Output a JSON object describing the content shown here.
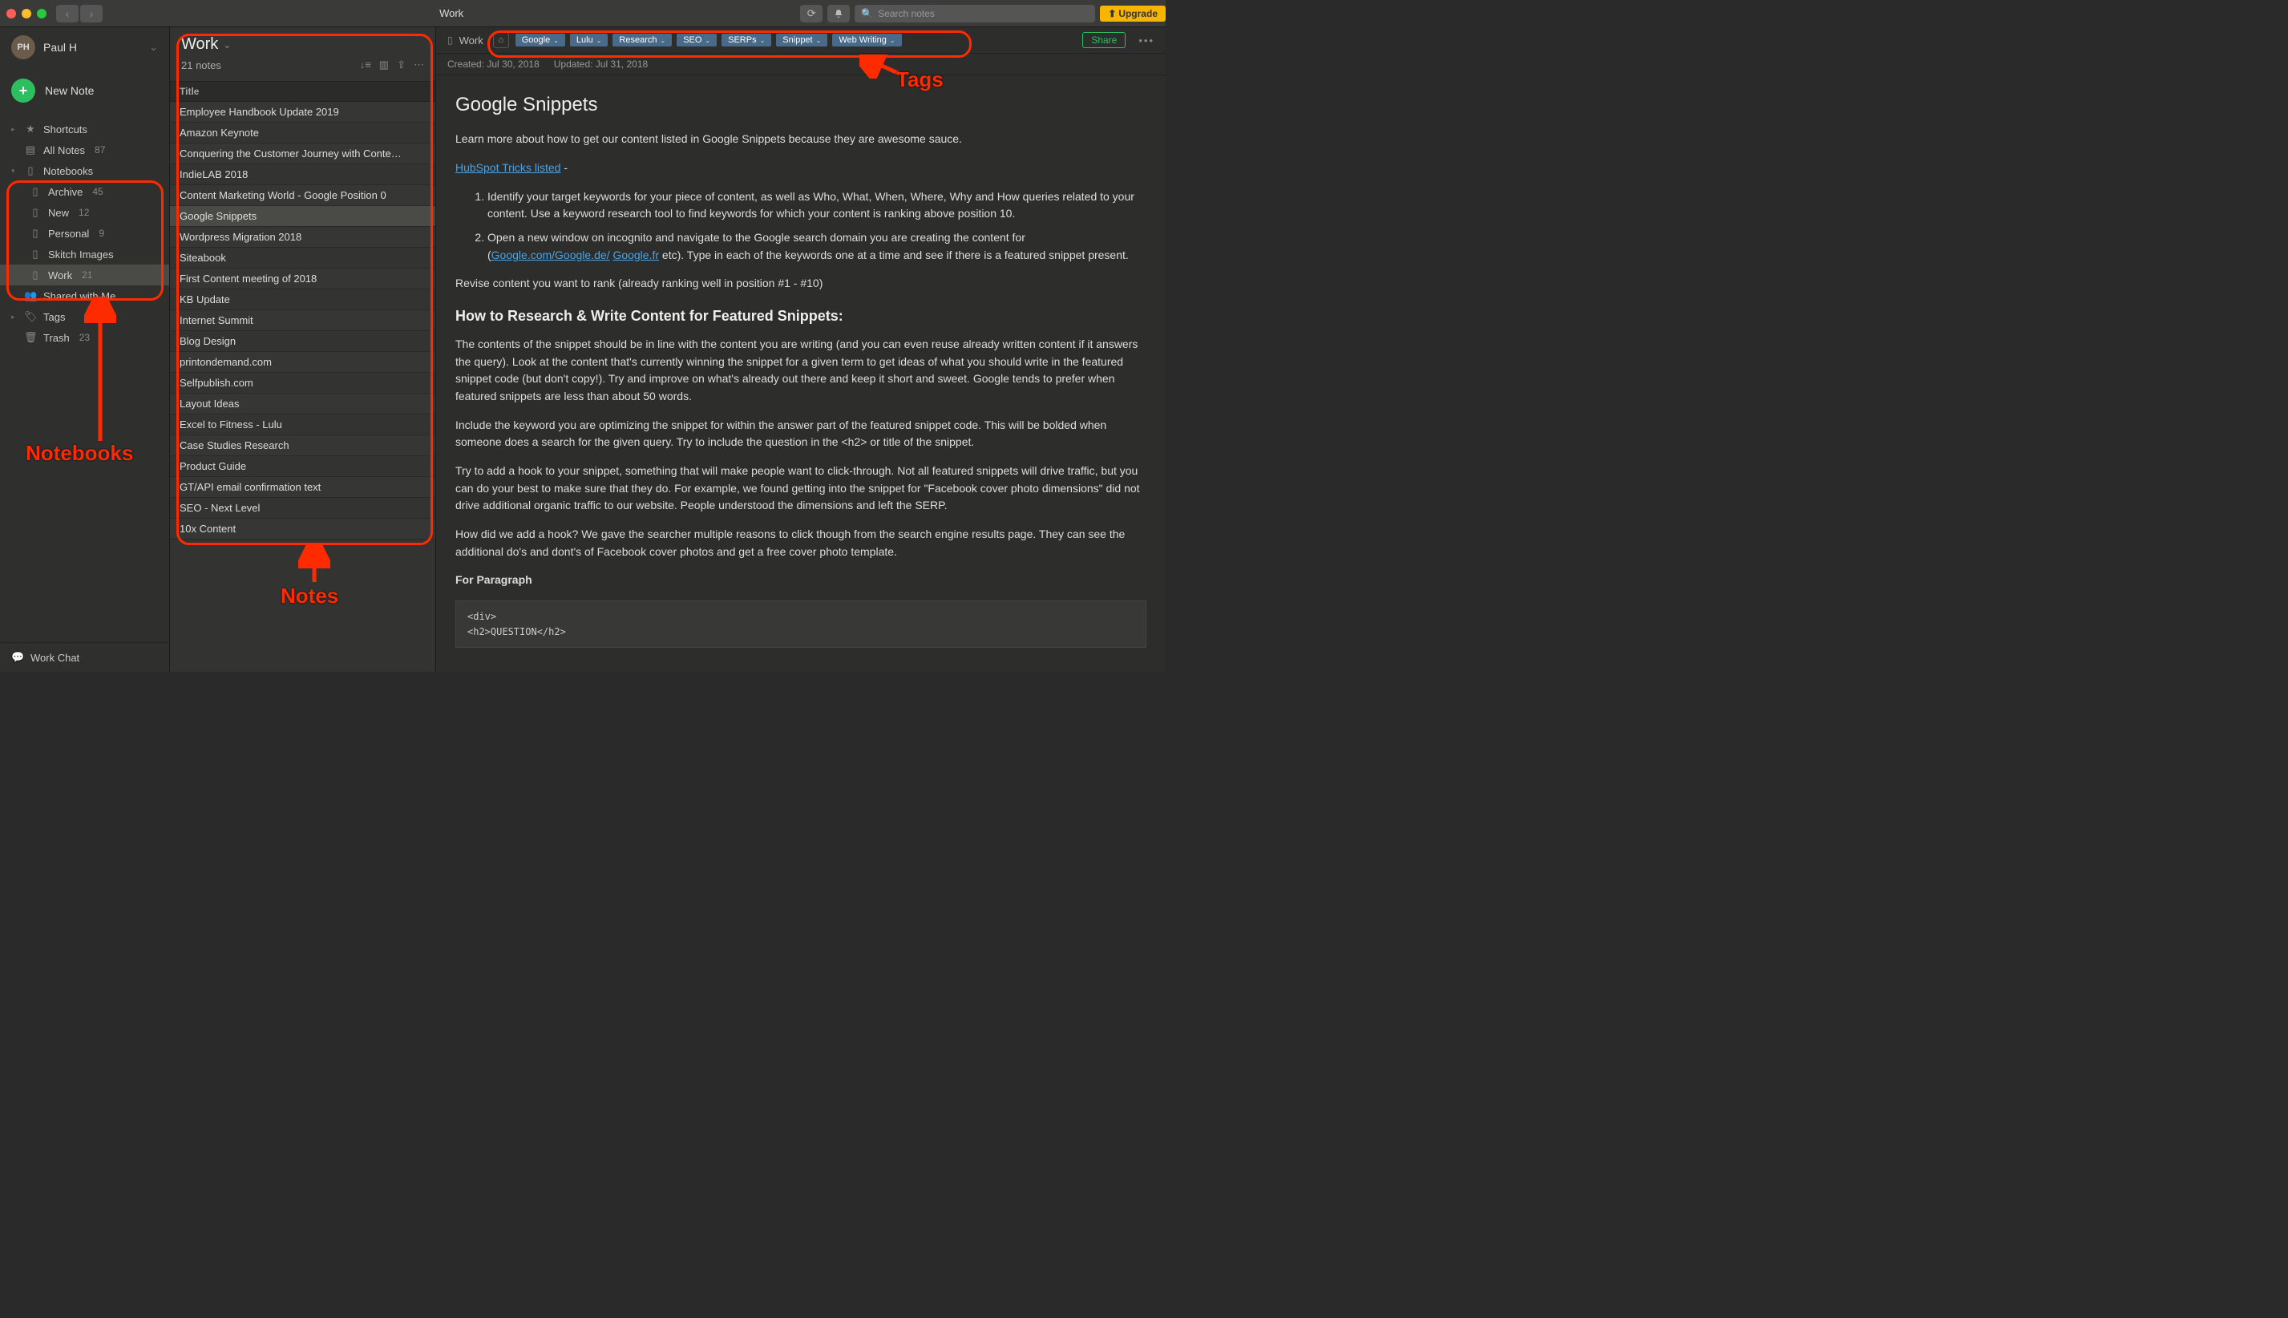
{
  "topbar": {
    "title": "Work",
    "search_placeholder": "Search notes",
    "upgrade": "Upgrade"
  },
  "user": {
    "name": "Paul H",
    "initials": "PH"
  },
  "newnote_label": "New Note",
  "nav": {
    "shortcuts": "Shortcuts",
    "allnotes": "All Notes",
    "allnotes_count": "87",
    "notebooks": "Notebooks",
    "shared": "Shared with Me",
    "tags": "Tags",
    "trash": "Trash",
    "trash_count": "23",
    "workchat": "Work Chat",
    "notebook_items": [
      {
        "label": "Archive",
        "count": "45"
      },
      {
        "label": "New",
        "count": "12"
      },
      {
        "label": "Personal",
        "count": "9"
      },
      {
        "label": "Skitch Images",
        "count": ""
      },
      {
        "label": "Work",
        "count": "21",
        "selected": true
      }
    ]
  },
  "notelist": {
    "title": "Work",
    "count": "21 notes",
    "col_title": "Title",
    "rows": [
      "Employee Handbook Update 2019",
      "Amazon Keynote",
      "Conquering the Customer Journey with Conte…",
      "IndieLAB 2018",
      "Content Marketing World - Google Position 0",
      "Google Snippets",
      "Wordpress Migration 2018",
      "Siteabook",
      "First Content meeting of 2018",
      "KB Update",
      "Internet Summit",
      "Blog Design",
      "printondemand.com",
      "Selfpublish.com",
      "Layout Ideas",
      "Excel to Fitness - Lulu",
      "Case Studies Research",
      "Product Guide",
      "GT/API email confirmation text",
      "SEO - Next Level",
      "10x Content"
    ],
    "selected_index": 5
  },
  "editor": {
    "notebook": "Work",
    "tags": [
      "Google",
      "Lulu",
      "Research",
      "SEO",
      "SERPs",
      "Snippet",
      "Web Writing"
    ],
    "share": "Share",
    "created": "Created: Jul 30, 2018",
    "updated": "Updated: Jul 31, 2018",
    "title": "Google Snippets",
    "lead": "Learn more about how to get our content listed in Google Snippets because they are awesome sauce.",
    "link1_text": "HubSpot Tricks listed",
    "link1_suffix": " -",
    "ol1": "Identify your target keywords for your piece of content, as well as Who, What, When, Where, Why and How queries related to your content. Use a keyword research tool to find keywords for which your content is ranking above position 10.",
    "ol2_prefix": "Open a new window on incognito and navigate to the Google search domain you are creating the content for (",
    "ol2_link1": "Google.com/Google.de/",
    "ol2_link2": "Google.fr",
    "ol2_suffix": " etc). Type in each of the keywords one at a time and see if there is a featured snippet present.",
    "revise": "Revise content you want to rank (already ranking well in position #1 - #10)",
    "h2": "How to Research & Write Content for Featured Snippets:",
    "p1": "The contents of the snippet should be in line with the content you are writing (and you can even reuse already written content if it answers the query). Look at the content that's currently winning the snippet for a given term to get ideas of what you should write in the featured snippet code (but don't copy!). Try and improve on what's already out there and keep it short and sweet. Google tends to prefer when featured snippets are less than about 50 words.",
    "p2": "Include the keyword you are optimizing the snippet for within the answer part of the featured snippet code. This will be bolded when someone does a search for the given query. Try to include the question in the <h2> or title of the snippet.",
    "p3": "Try to add a hook to your snippet, something that will make people want to click-through. Not all featured snippets will drive traffic, but you can do your best to make sure that they do. For example, we found getting into the snippet for \"Facebook cover photo dimensions\" did not drive additional organic traffic to our website. People understood the dimensions and left the SERP.",
    "p4": "How did we add a hook? We gave the searcher multiple reasons to click though from the search engine results page. They can see the additional  do's and dont's of Facebook cover photos and get a free cover photo template.",
    "p5": "For Paragraph",
    "code1": "<div>",
    "code2": "<h2>QUESTION</h2>"
  },
  "anno": {
    "notebooks": "Notebooks",
    "notes": "Notes",
    "tags": "Tags"
  }
}
